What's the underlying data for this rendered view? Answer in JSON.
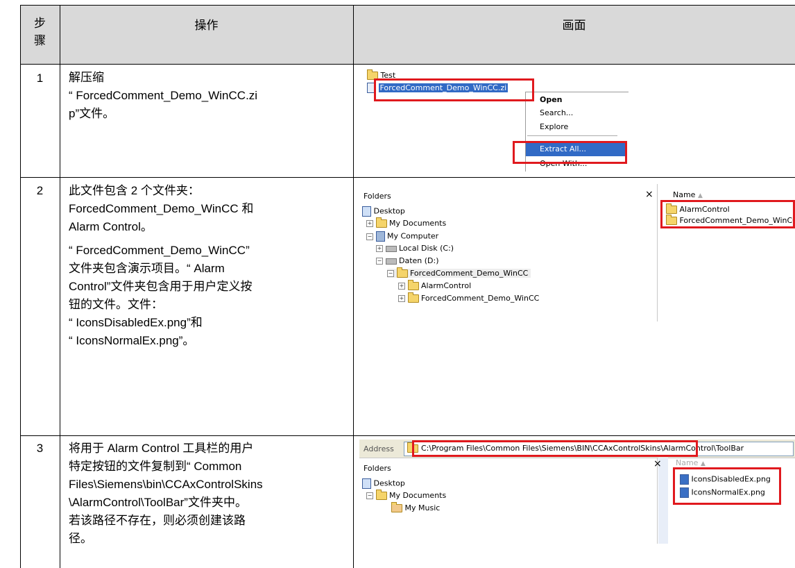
{
  "header": {
    "step_col": "步骤",
    "op_col": "操作",
    "screen_col": "画面"
  },
  "steps": [
    {
      "num": "1",
      "lines": [
        "解压缩",
        "“ ForcedComment_Demo_WinCC.zi",
        "p”文件。"
      ],
      "shot": {
        "folder_test": "Test",
        "zip_name": "ForcedComment_Demo_WinCC.zi",
        "menu": [
          "Open",
          "Search...",
          "Explore",
          "Extract All...",
          "Open With..."
        ]
      }
    },
    {
      "num": "2",
      "lines": [
        "此文件包含 2 个文件夹：",
        "ForcedComment_Demo_WinCC 和",
        "Alarm Control。",
        "“ ForcedComment_Demo_WinCC”",
        "文件夹包含演示项目。“ Alarm",
        "Control”文件夹包含用于用户定义按",
        "钮的文件。文件：",
        "“ IconsDisabledEx.png”和",
        "“ IconsNormalEx.png”。"
      ],
      "shot": {
        "pane_title": "Folders",
        "close": "×",
        "name_col": "Name",
        "tree": [
          "Desktop",
          "My Documents",
          "My Computer",
          "Local Disk (C:)",
          "Daten (D:)",
          "ForcedComment_Demo_WinCC",
          "AlarmControl",
          "ForcedComment_Demo_WinCC"
        ],
        "files": [
          "AlarmControl",
          "ForcedComment_Demo_WinCC"
        ]
      }
    },
    {
      "num": "3",
      "lines": [
        "将用于 Alarm Control 工具栏的用户",
        "特定按钮的文件复制到“ Common",
        "Files\\Siemens\\bin\\CCAxControlSkins",
        "\\AlarmControl\\ToolBar”文件夹中。",
        "若该路径不存在，则必须创建该路",
        "径。"
      ],
      "shot": {
        "address_label": "Address",
        "address": "C:\\Program Files\\Common Files\\Siemens\\BIN\\CCAxControlSkins\\AlarmControl\\ToolBar",
        "pane_title": "Folders",
        "close": "×",
        "name_col": "Name",
        "tree": [
          "Desktop",
          "My Documents",
          "My Music"
        ],
        "files": [
          "IconsDisabledEx.png",
          "IconsNormalEx.png"
        ]
      }
    }
  ]
}
